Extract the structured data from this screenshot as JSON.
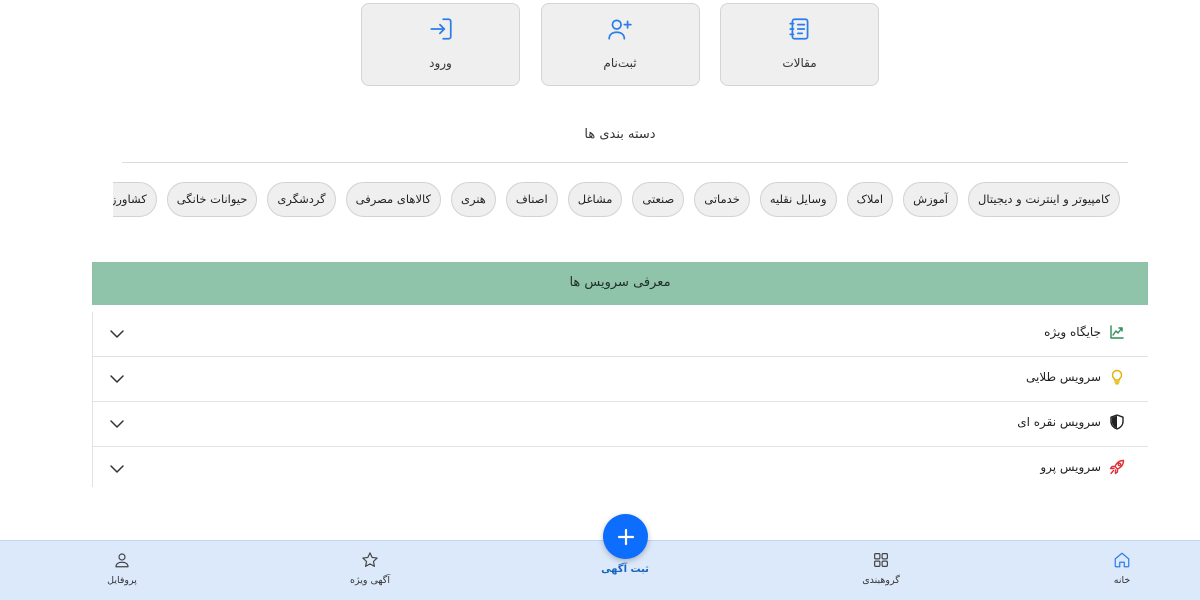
{
  "top_actions": [
    {
      "label": "ورود",
      "icon": "login-icon"
    },
    {
      "label": "ثبت‌نام",
      "icon": "user-plus-icon"
    },
    {
      "label": "مقالات",
      "icon": "articles-icon"
    }
  ],
  "categories": {
    "title": "دسته بندی ها",
    "items": [
      "کامپیوتر و اینترنت و دیجیتال",
      "آموزش",
      "املاک",
      "وسایل نقلیه",
      "خدماتی",
      "صنعتی",
      "مشاغل",
      "اصناف",
      "هنری",
      "کالاهای مصرفی",
      "گردشگری",
      "حیوانات خانگی",
      "کشاورزی و دامداری"
    ]
  },
  "services": {
    "title": "معرفی سرویس ها",
    "items": [
      {
        "label": "جایگاه ویژه",
        "icon": "chart-up-icon",
        "icon_color": "#2e8b57"
      },
      {
        "label": "سرویس طلایی",
        "icon": "lightbulb-icon",
        "icon_color": "#e0b400"
      },
      {
        "label": "سرویس نقره ای",
        "icon": "shield-icon",
        "icon_color": "#222222"
      },
      {
        "label": "سرویس پرو",
        "icon": "rocket-icon",
        "icon_color": "#e0303a"
      }
    ]
  },
  "bottom_nav": {
    "home": "خانه",
    "categories": "گروهبندی",
    "post_ad": "ثبت آگهی",
    "featured": "آگهی ویژه",
    "profile": "پروفایل"
  },
  "colors": {
    "accent": "#0d6efd",
    "services_header": "#8fc4ab",
    "nav_bg": "#dbe9fb"
  }
}
